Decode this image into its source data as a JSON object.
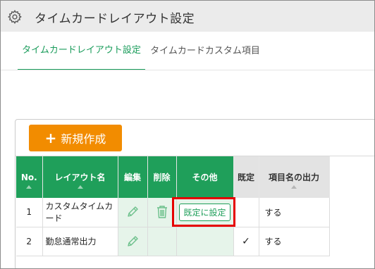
{
  "window": {
    "title": "タイムカードレイアウト設定",
    "icon": "gear-icon"
  },
  "tabs": [
    {
      "label": "タイムカードレイアウト設定",
      "active": true
    },
    {
      "label": "タイムカードカスタム項目",
      "active": false
    }
  ],
  "toolbar": {
    "new_label": "新規作成",
    "new_icon": "plus-icon"
  },
  "table": {
    "headers": [
      "No.",
      "レイアウト名",
      "編集",
      "削除",
      "その他",
      "既定",
      "項目名の出力"
    ],
    "rows": [
      {
        "no": "1",
        "name": "カスタムタイムカード",
        "edit_icon": "pencil-icon",
        "delete_icon": "trash-icon",
        "other": "既定に設定",
        "default": "",
        "output": "する"
      },
      {
        "no": "2",
        "name": "勤怠通常出力",
        "edit_icon": "pencil-icon",
        "delete_icon": "",
        "other": "",
        "default": "✓",
        "output": "する"
      }
    ]
  },
  "colors": {
    "accent": "#1f9f5a",
    "new_button": "#f28c00",
    "highlight": "#e60000"
  }
}
